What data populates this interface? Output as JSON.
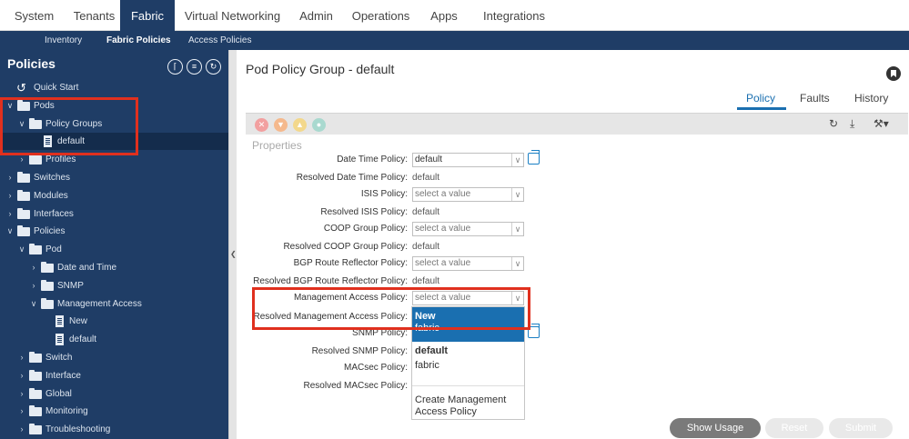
{
  "top_nav": {
    "tabs": [
      "System",
      "Tenants",
      "Fabric",
      "Virtual Networking",
      "Admin",
      "Operations",
      "Apps",
      "Integrations"
    ],
    "active": "Fabric"
  },
  "sub_nav": {
    "items": [
      "Inventory",
      "Fabric Policies",
      "Access Policies"
    ],
    "active": "Fabric Policies"
  },
  "sidebar": {
    "title": "Policies",
    "icons": [
      "collapse-all-icon",
      "list-icon",
      "refresh-icon"
    ],
    "tree": [
      {
        "label": "Quick Start",
        "icon": "quick-start-icon",
        "arrow": ""
      },
      {
        "label": "Pods",
        "icon": "folder-icon",
        "arrow": "open"
      },
      {
        "label": "Policy Groups",
        "icon": "folder-icon",
        "arrow": "open"
      },
      {
        "label": "default",
        "icon": "document-icon",
        "arrow": "",
        "selected": true
      },
      {
        "label": "Profiles",
        "icon": "folder-icon",
        "arrow": "closed"
      },
      {
        "label": "Switches",
        "icon": "folder-icon",
        "arrow": "closed"
      },
      {
        "label": "Modules",
        "icon": "folder-icon",
        "arrow": "closed"
      },
      {
        "label": "Interfaces",
        "icon": "folder-icon",
        "arrow": "closed"
      },
      {
        "label": "Policies",
        "icon": "folder-icon",
        "arrow": "open"
      },
      {
        "label": "Pod",
        "icon": "folder-icon",
        "arrow": "open"
      },
      {
        "label": "Date and Time",
        "icon": "folder-icon",
        "arrow": "closed"
      },
      {
        "label": "SNMP",
        "icon": "folder-icon",
        "arrow": "closed"
      },
      {
        "label": "Management Access",
        "icon": "folder-icon",
        "arrow": "open"
      },
      {
        "label": "New",
        "icon": "document-icon",
        "arrow": ""
      },
      {
        "label": "default",
        "icon": "document-icon",
        "arrow": ""
      },
      {
        "label": "Switch",
        "icon": "folder-icon",
        "arrow": "closed"
      },
      {
        "label": "Interface",
        "icon": "folder-icon",
        "arrow": "closed"
      },
      {
        "label": "Global",
        "icon": "folder-icon",
        "arrow": "closed"
      },
      {
        "label": "Monitoring",
        "icon": "folder-icon",
        "arrow": "closed"
      },
      {
        "label": "Troubleshooting",
        "icon": "folder-icon",
        "arrow": "closed"
      }
    ]
  },
  "main": {
    "title": "Pod Policy Group - default",
    "tabs": [
      "Policy",
      "Faults",
      "History"
    ],
    "active_tab": "Policy",
    "section": "Properties",
    "fields": [
      {
        "label": "Date Time Policy:",
        "kind": "select",
        "value": "default",
        "placeholder": "",
        "link": true
      },
      {
        "label": "Resolved Date Time Policy:",
        "kind": "text",
        "value": "default"
      },
      {
        "label": "ISIS Policy:",
        "kind": "select",
        "value": "",
        "placeholder": "select a value",
        "link": false
      },
      {
        "label": "Resolved ISIS Policy:",
        "kind": "text",
        "value": "default"
      },
      {
        "label": "COOP Group Policy:",
        "kind": "select",
        "value": "",
        "placeholder": "select a value",
        "link": false
      },
      {
        "label": "Resolved COOP Group Policy:",
        "kind": "text",
        "value": "default"
      },
      {
        "label": "BGP Route Reflector Policy:",
        "kind": "select",
        "value": "",
        "placeholder": "select a value",
        "link": false
      },
      {
        "label": "Resolved BGP Route Reflector Policy:",
        "kind": "text",
        "value": "default"
      },
      {
        "label": "Management Access Policy:",
        "kind": "select",
        "value": "",
        "placeholder": "select a value",
        "link": false,
        "open": true
      },
      {
        "label": "Resolved Management Access Policy:",
        "kind": "text",
        "value": ""
      },
      {
        "label": "SNMP Policy:",
        "kind": "none",
        "value": "",
        "link": true
      },
      {
        "label": "Resolved SNMP Policy:",
        "kind": "text",
        "value": ""
      },
      {
        "label": "MACsec Policy:",
        "kind": "text",
        "value": ""
      },
      {
        "label": "Resolved MACsec Policy:",
        "kind": "text",
        "value": ""
      }
    ],
    "dropdown": {
      "highlighted": "New",
      "highlighted_sub": "fabric",
      "items": [
        {
          "label": "default",
          "bold": true
        },
        {
          "label": "fabric",
          "bold": false
        }
      ],
      "create_label": "Create Management Access Policy"
    },
    "buttons": {
      "show_usage": "Show Usage",
      "reset": "Reset",
      "submit": "Submit"
    }
  },
  "colors": {
    "nav_bg": "#1f3d66",
    "accent": "#1a6fb0",
    "highlight_border": "#e0301e"
  }
}
